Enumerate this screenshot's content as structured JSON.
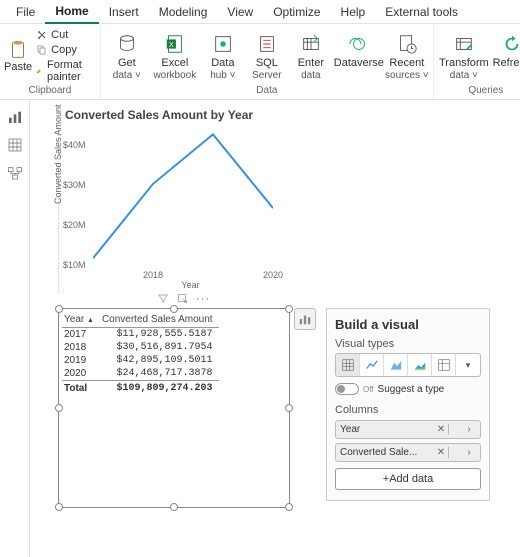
{
  "menu": [
    "File",
    "Home",
    "Insert",
    "Modeling",
    "View",
    "Optimize",
    "Help",
    "External tools"
  ],
  "menu_active": 1,
  "ribbon": {
    "clipboard": {
      "group_label": "Clipboard",
      "paste": "Paste",
      "cut": "Cut",
      "copy": "Copy",
      "format_painter": "Format painter"
    },
    "data": {
      "group_label": "Data",
      "get_data": "Get",
      "get_data_sub": "data ˅",
      "excel": "Excel",
      "excel_sub": "workbook",
      "data_hub": "Data",
      "data_hub_sub": "hub ˅",
      "sql": "SQL",
      "sql_sub": "Server",
      "enter": "Enter",
      "enter_sub": "data",
      "dataverse": "Dataverse",
      "recent": "Recent",
      "recent_sub": "sources ˅"
    },
    "queries": {
      "group_label": "Queries",
      "transform": "Transform",
      "transform_sub": "data ˅",
      "refresh": "Refresh"
    }
  },
  "chart_data": {
    "type": "line",
    "title": "Converted Sales Amount by Year",
    "xlabel": "Year",
    "ylabel": "Converted Sales Amount",
    "ylim": [
      10000000,
      45000000
    ],
    "yticks": [
      "$10M",
      "$20M",
      "$30M",
      "$40M"
    ],
    "x": [
      2017,
      2018,
      2019,
      2020
    ],
    "xticks": [
      "2018",
      "2020"
    ],
    "values": [
      11928555.5187,
      30516891.7954,
      42895109.5011,
      24468717.3878
    ]
  },
  "table": {
    "columns": [
      "Year",
      "Converted Sales Amount"
    ],
    "rows": [
      {
        "year": "2017",
        "amount": "$11,928,555.5187"
      },
      {
        "year": "2018",
        "amount": "$30,516,891.7954"
      },
      {
        "year": "2019",
        "amount": "$42,895,109.5011"
      },
      {
        "year": "2020",
        "amount": "$24,468,717.3878"
      }
    ],
    "total_label": "Total",
    "total_value": "$109,809,274.203"
  },
  "build": {
    "title": "Build a visual",
    "visual_types_label": "Visual types",
    "suggest": "Suggest a type",
    "suggest_state": "Off",
    "columns_label": "Columns",
    "fields": [
      {
        "name": "Year"
      },
      {
        "name": "Converted Sale..."
      }
    ],
    "add_data": "+Add data"
  }
}
